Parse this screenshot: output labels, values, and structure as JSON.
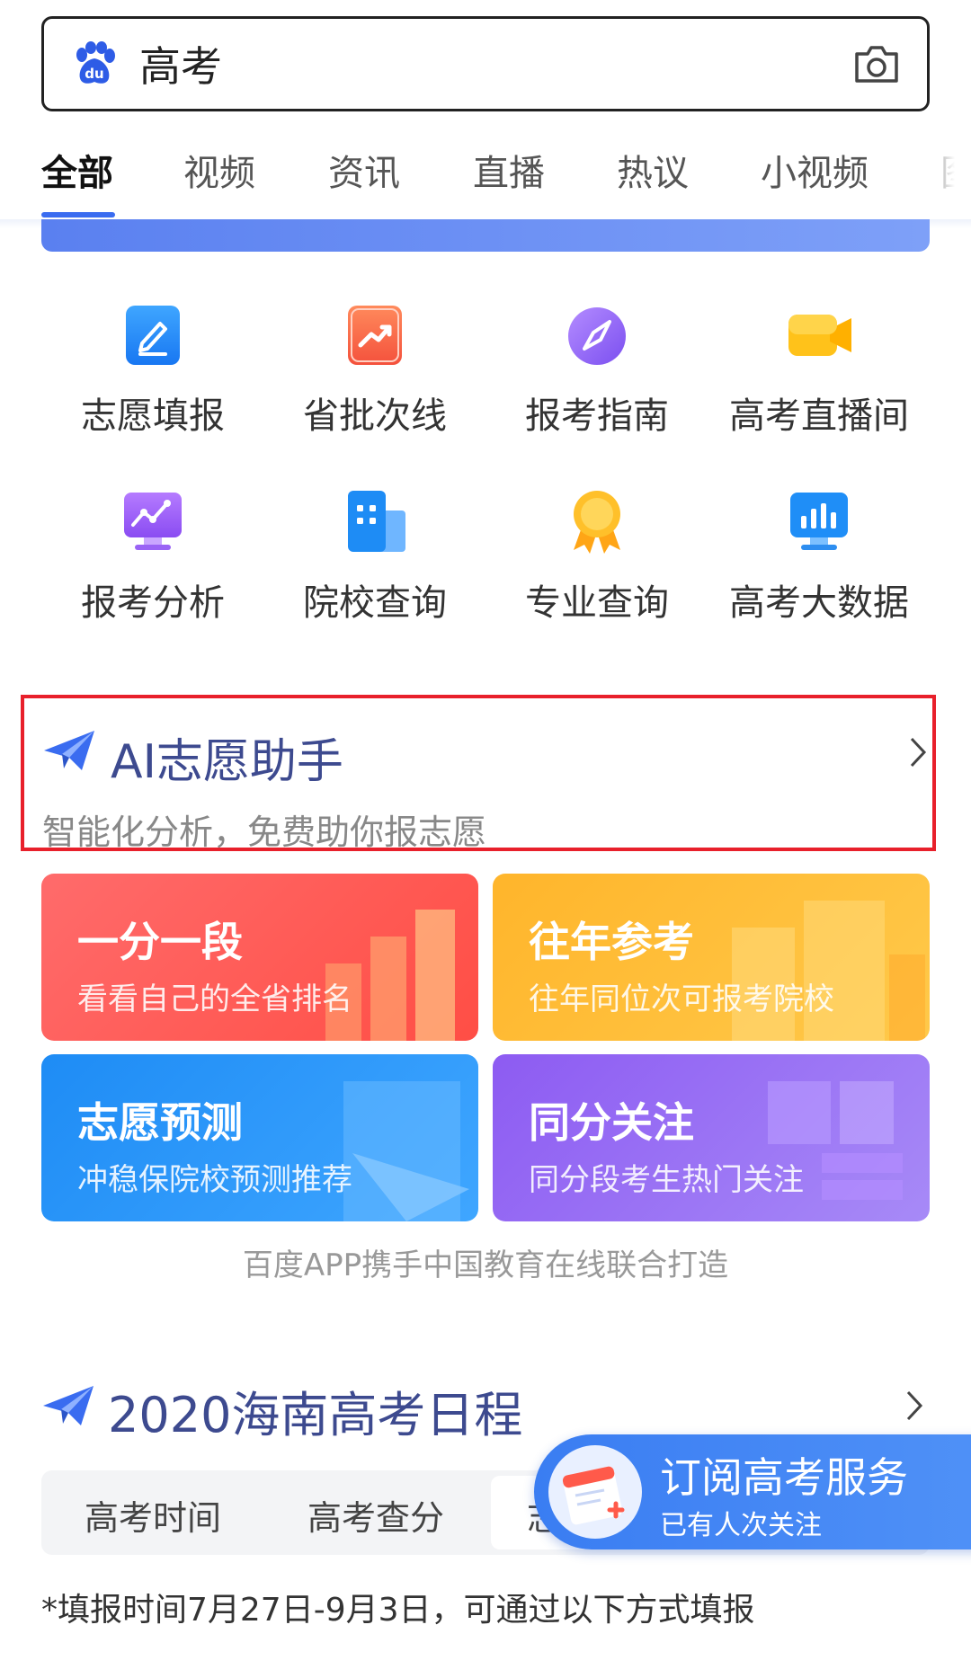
{
  "search": {
    "query": "高考"
  },
  "tabs": [
    "全部",
    "视频",
    "资讯",
    "直播",
    "热议",
    "小视频",
    "图"
  ],
  "grid": [
    {
      "label": "志愿填报",
      "icon": "pencil-icon"
    },
    {
      "label": "省批次线",
      "icon": "trend-icon"
    },
    {
      "label": "报考指南",
      "icon": "compass-icon"
    },
    {
      "label": "高考直播间",
      "icon": "video-icon"
    },
    {
      "label": "报考分析",
      "icon": "chart-monitor-icon"
    },
    {
      "label": "院校查询",
      "icon": "building-icon"
    },
    {
      "label": "专业查询",
      "icon": "medal-icon"
    },
    {
      "label": "高考大数据",
      "icon": "bar-monitor-icon"
    }
  ],
  "ai": {
    "title": "AI志愿助手",
    "subtitle": "智能化分析，免费助你报志愿"
  },
  "cards": [
    {
      "title": "一分一段",
      "subtitle": "看看自己的全省排名"
    },
    {
      "title": "往年参考",
      "subtitle": "往年同位次可报考院校"
    },
    {
      "title": "志愿预测",
      "subtitle": "冲稳保院校预测推荐"
    },
    {
      "title": "同分关注",
      "subtitle": "同分段考生热门关注"
    }
  ],
  "credit": "百度APP携手中国教育在线联合打造",
  "schedule": {
    "title": "2020海南高考日程",
    "tabs": [
      "高考时间",
      "高考查分",
      "志"
    ],
    "note": "*填报时间7月27日-9月3日，可通过以下方式填报"
  },
  "subscribe": {
    "title": "订阅高考服务",
    "subtitle": "已有人次关注"
  },
  "colors": {
    "accent": "#3a6cf0",
    "highlight_border": "#e8202b",
    "title_navy": "#3d4a8f"
  }
}
